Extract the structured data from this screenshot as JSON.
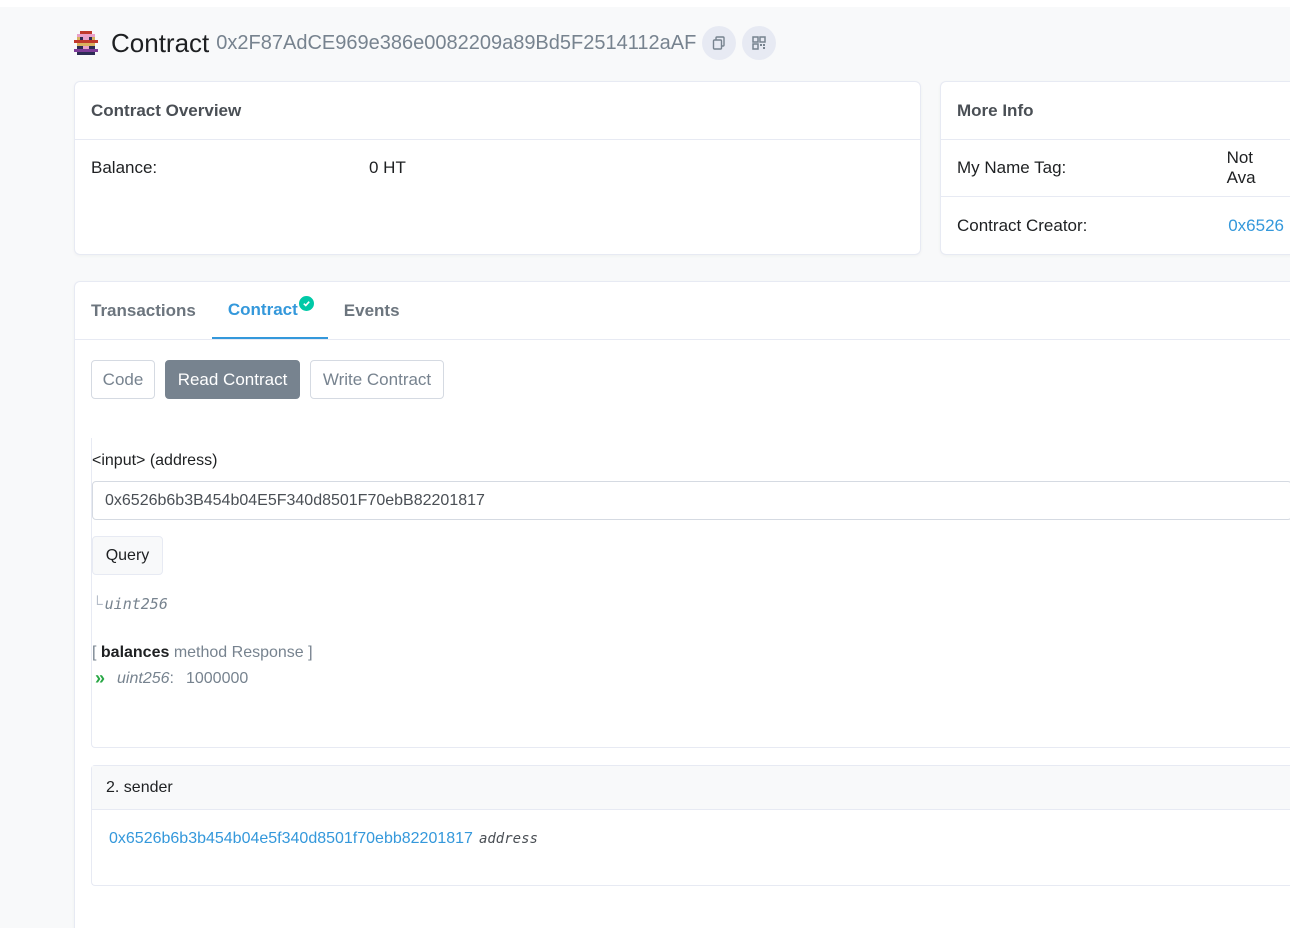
{
  "header": {
    "title": "Contract",
    "address": "0x2F87AdCE969e386e0082209a89Bd5F2514112aAF",
    "copy_icon": "copy-icon",
    "qr_icon": "qr-code-icon"
  },
  "overview": {
    "title": "Contract Overview",
    "balance_label": "Balance:",
    "balance_value": "0 HT"
  },
  "more_info": {
    "title": "More Info",
    "name_tag_label": "My Name Tag:",
    "name_tag_value": "Not Ava",
    "creator_label": "Contract Creator:",
    "creator_value": "0x6526"
  },
  "tabs": [
    {
      "label": "Transactions",
      "active": false
    },
    {
      "label": "Contract",
      "active": true,
      "verified_icon": "check-circle-icon"
    },
    {
      "label": "Events",
      "active": false
    }
  ],
  "subtabs": [
    {
      "label": "Code",
      "active": false
    },
    {
      "label": "Read Contract",
      "active": true
    },
    {
      "label": "Write Contract",
      "active": false
    }
  ],
  "read": {
    "input_label": "<input> (address)",
    "input_value": "0x6526b6b3B454b04E5F340d8501F70ebB82201817",
    "query_label": "Query",
    "output_type": "uint256",
    "response_open": "[ ",
    "response_method": "balances",
    "response_rest": " method Response ]",
    "result_type": "uint256",
    "result_sep": " :",
    "result_value": "1000000"
  },
  "sender": {
    "title": "2. sender",
    "value": "0x6526b6b3b454b04e5f340d8501f70ebb82201817",
    "type": "address"
  },
  "colors": {
    "accent": "#3498db",
    "verified": "#00c9a7",
    "result_arrow": "#28a745",
    "active_subtab": "#77838f"
  }
}
